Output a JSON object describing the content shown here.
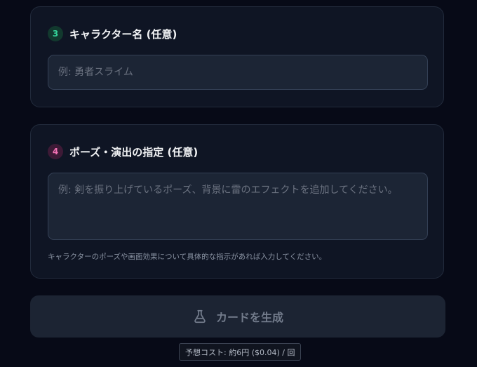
{
  "step3": {
    "number": "3",
    "title": "キャラクター名 (任意)",
    "input_value": "",
    "input_placeholder": "例: 勇者スライム",
    "badge_color": "#34d399"
  },
  "step4": {
    "number": "4",
    "title": "ポーズ・演出の指定 (任意)",
    "textarea_value": "",
    "textarea_placeholder": "例: 剣を振り上げているポーズ、背景に雷のエフェクトを追加してください。",
    "hint": "キャラクターのポーズや画面効果について具体的な指示があれば入力してください。",
    "badge_color": "#f472b6"
  },
  "generate_button": {
    "label": "カードを生成",
    "icon": "flask-icon",
    "disabled": true
  },
  "cost_note": "予想コスト: 約6円 ($0.04) / 回",
  "colors": {
    "background": "#070a17",
    "card": "#0f1524",
    "input": "#1c2535",
    "button": "#1c2433"
  }
}
